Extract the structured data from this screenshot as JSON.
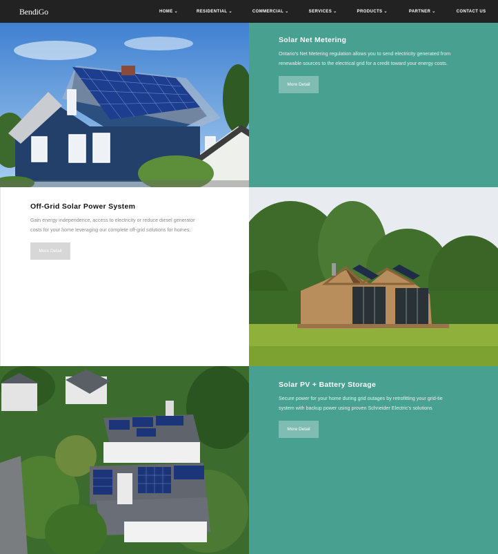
{
  "nav": {
    "logo": "BendiGo",
    "items": [
      {
        "label": "HOME",
        "dropdown": true
      },
      {
        "label": "RESIDENTIAL",
        "dropdown": true
      },
      {
        "label": "COMMERCIAL",
        "dropdown": true
      },
      {
        "label": "SERVICES",
        "dropdown": true
      },
      {
        "label": "PRODUCTS",
        "dropdown": true
      },
      {
        "label": "PARTNER",
        "dropdown": true
      },
      {
        "label": "CONTACT US",
        "dropdown": false
      }
    ]
  },
  "sections": [
    {
      "title": "Solar Net Metering",
      "text": "Ontario's Net Metering regulation allows you to send electricity generated from renewable sources to the electrical grid for a credit toward your energy costs.",
      "button": "More Detail",
      "image": "blue-house-with-rooftop-solar-panels"
    },
    {
      "title": "Off-Grid Solar Power System",
      "text": "Gain energy independence, access to electricity or reduce diesel generator costs for your home leveraging our complete off-grid solutions for homes.",
      "button": "More Detail",
      "image": "wooden-off-grid-cabin-with-solar-panels-in-meadow"
    },
    {
      "title": "Solar PV + Battery Storage",
      "text": "Secure power for your home during grid outages by retrofitting your grid-tie system with backup power using proven Schneider Electric's solutions",
      "button": "More Detail",
      "image": "aerial-view-of-house-with-solar-panels-among-trees"
    }
  ],
  "colors": {
    "nav_bg": "#222222",
    "teal": "#48a090",
    "teal_button": "#7fbcb1",
    "grey_button": "#d7d7d7"
  }
}
